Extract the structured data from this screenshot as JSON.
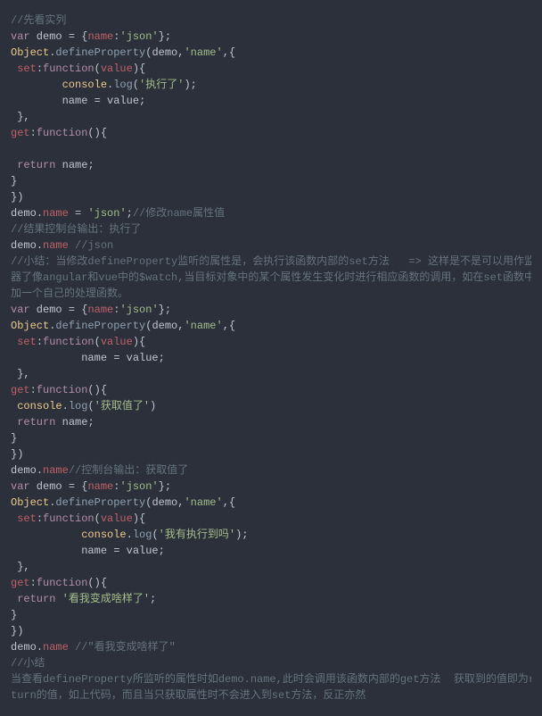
{
  "code": {
    "lines": [
      {
        "segments": [
          {
            "cls": "comment",
            "text": "//先看实列"
          }
        ]
      },
      {
        "segments": [
          {
            "cls": "keyword",
            "text": "var"
          },
          {
            "cls": "plain",
            "text": " demo "
          },
          {
            "cls": "punctuation",
            "text": "= {"
          },
          {
            "cls": "property",
            "text": "name"
          },
          {
            "cls": "punctuation",
            "text": ":"
          },
          {
            "cls": "string",
            "text": "'json'"
          },
          {
            "cls": "punctuation",
            "text": "};"
          }
        ]
      },
      {
        "segments": [
          {
            "cls": "object",
            "text": "Object"
          },
          {
            "cls": "punctuation",
            "text": "."
          },
          {
            "cls": "function-name",
            "text": "defineProperty"
          },
          {
            "cls": "punctuation",
            "text": "("
          },
          {
            "cls": "plain",
            "text": "demo"
          },
          {
            "cls": "punctuation",
            "text": ","
          },
          {
            "cls": "string",
            "text": "'name'"
          },
          {
            "cls": "punctuation",
            "text": ",{"
          }
        ]
      },
      {
        "segments": [
          {
            "cls": "plain",
            "text": " "
          },
          {
            "cls": "property",
            "text": "set"
          },
          {
            "cls": "punctuation",
            "text": ":"
          },
          {
            "cls": "keyword",
            "text": "function"
          },
          {
            "cls": "punctuation",
            "text": "("
          },
          {
            "cls": "variable",
            "text": "value"
          },
          {
            "cls": "punctuation",
            "text": "){"
          }
        ]
      },
      {
        "segments": [
          {
            "cls": "plain",
            "text": "        "
          },
          {
            "cls": "object",
            "text": "console"
          },
          {
            "cls": "punctuation",
            "text": "."
          },
          {
            "cls": "function-name",
            "text": "log"
          },
          {
            "cls": "punctuation",
            "text": "("
          },
          {
            "cls": "string",
            "text": "'执行了'"
          },
          {
            "cls": "punctuation",
            "text": ");"
          }
        ]
      },
      {
        "segments": [
          {
            "cls": "plain",
            "text": "        name "
          },
          {
            "cls": "punctuation",
            "text": "="
          },
          {
            "cls": "plain",
            "text": " value"
          },
          {
            "cls": "punctuation",
            "text": ";"
          }
        ]
      },
      {
        "segments": [
          {
            "cls": "plain",
            "text": " "
          },
          {
            "cls": "punctuation",
            "text": "},"
          }
        ]
      },
      {
        "segments": [
          {
            "cls": "property",
            "text": "get"
          },
          {
            "cls": "punctuation",
            "text": ":"
          },
          {
            "cls": "keyword",
            "text": "function"
          },
          {
            "cls": "punctuation",
            "text": "(){"
          }
        ]
      },
      {
        "segments": [
          {
            "cls": "plain",
            "text": " "
          }
        ]
      },
      {
        "segments": [
          {
            "cls": "plain",
            "text": " "
          },
          {
            "cls": "keyword",
            "text": "return"
          },
          {
            "cls": "plain",
            "text": " name"
          },
          {
            "cls": "punctuation",
            "text": ";"
          }
        ]
      },
      {
        "segments": [
          {
            "cls": "punctuation",
            "text": "}"
          }
        ]
      },
      {
        "segments": [
          {
            "cls": "punctuation",
            "text": "})"
          }
        ]
      },
      {
        "segments": [
          {
            "cls": "plain",
            "text": "demo"
          },
          {
            "cls": "punctuation",
            "text": "."
          },
          {
            "cls": "property",
            "text": "name"
          },
          {
            "cls": "plain",
            "text": " "
          },
          {
            "cls": "punctuation",
            "text": "="
          },
          {
            "cls": "plain",
            "text": " "
          },
          {
            "cls": "string",
            "text": "'json'"
          },
          {
            "cls": "punctuation",
            "text": ";"
          },
          {
            "cls": "comment",
            "text": "//修改name属性值"
          }
        ]
      },
      {
        "segments": [
          {
            "cls": "comment",
            "text": "//结果控制台输出：执行了"
          }
        ]
      },
      {
        "segments": [
          {
            "cls": "plain",
            "text": "demo"
          },
          {
            "cls": "punctuation",
            "text": "."
          },
          {
            "cls": "property",
            "text": "name"
          },
          {
            "cls": "plain",
            "text": " "
          },
          {
            "cls": "comment",
            "text": "//json"
          }
        ]
      },
      {
        "segments": [
          {
            "cls": "comment",
            "text": "//小结：当修改defineProperty监听的属性是，会执行该函数内部的set方法   => 这样是不是可以用作监听"
          }
        ]
      },
      {
        "segments": [
          {
            "cls": "comment",
            "text": "器了像angular和vue中的$watch,当目标对象中的某个属性发生变化时进行相应函数的调用，如在set函数中"
          }
        ]
      },
      {
        "segments": [
          {
            "cls": "comment",
            "text": "加一个自己的处理函数。"
          }
        ]
      },
      {
        "segments": [
          {
            "cls": "keyword",
            "text": "var"
          },
          {
            "cls": "plain",
            "text": " demo "
          },
          {
            "cls": "punctuation",
            "text": "= {"
          },
          {
            "cls": "property",
            "text": "name"
          },
          {
            "cls": "punctuation",
            "text": ":"
          },
          {
            "cls": "string",
            "text": "'json'"
          },
          {
            "cls": "punctuation",
            "text": "};"
          }
        ]
      },
      {
        "segments": [
          {
            "cls": "object",
            "text": "Object"
          },
          {
            "cls": "punctuation",
            "text": "."
          },
          {
            "cls": "function-name",
            "text": "defineProperty"
          },
          {
            "cls": "punctuation",
            "text": "("
          },
          {
            "cls": "plain",
            "text": "demo"
          },
          {
            "cls": "punctuation",
            "text": ","
          },
          {
            "cls": "string",
            "text": "'name'"
          },
          {
            "cls": "punctuation",
            "text": ",{"
          }
        ]
      },
      {
        "segments": [
          {
            "cls": "plain",
            "text": " "
          },
          {
            "cls": "property",
            "text": "set"
          },
          {
            "cls": "punctuation",
            "text": ":"
          },
          {
            "cls": "keyword",
            "text": "function"
          },
          {
            "cls": "punctuation",
            "text": "("
          },
          {
            "cls": "variable",
            "text": "value"
          },
          {
            "cls": "punctuation",
            "text": "){"
          }
        ]
      },
      {
        "segments": [
          {
            "cls": "plain",
            "text": "           name "
          },
          {
            "cls": "punctuation",
            "text": "="
          },
          {
            "cls": "plain",
            "text": " value"
          },
          {
            "cls": "punctuation",
            "text": ";"
          }
        ]
      },
      {
        "segments": [
          {
            "cls": "plain",
            "text": " "
          },
          {
            "cls": "punctuation",
            "text": "},"
          }
        ]
      },
      {
        "segments": [
          {
            "cls": "property",
            "text": "get"
          },
          {
            "cls": "punctuation",
            "text": ":"
          },
          {
            "cls": "keyword",
            "text": "function"
          },
          {
            "cls": "punctuation",
            "text": "(){"
          }
        ]
      },
      {
        "segments": [
          {
            "cls": "plain",
            "text": " "
          },
          {
            "cls": "object",
            "text": "console"
          },
          {
            "cls": "punctuation",
            "text": "."
          },
          {
            "cls": "function-name",
            "text": "log"
          },
          {
            "cls": "punctuation",
            "text": "("
          },
          {
            "cls": "string",
            "text": "'获取值了'"
          },
          {
            "cls": "punctuation",
            "text": ")"
          }
        ]
      },
      {
        "segments": [
          {
            "cls": "plain",
            "text": " "
          },
          {
            "cls": "keyword",
            "text": "return"
          },
          {
            "cls": "plain",
            "text": " name"
          },
          {
            "cls": "punctuation",
            "text": ";"
          }
        ]
      },
      {
        "segments": [
          {
            "cls": "punctuation",
            "text": "}"
          }
        ]
      },
      {
        "segments": [
          {
            "cls": "punctuation",
            "text": "})"
          }
        ]
      },
      {
        "segments": [
          {
            "cls": "plain",
            "text": "demo"
          },
          {
            "cls": "punctuation",
            "text": "."
          },
          {
            "cls": "property",
            "text": "name"
          },
          {
            "cls": "comment",
            "text": "//控制台输出：获取值了"
          }
        ]
      },
      {
        "segments": [
          {
            "cls": "keyword",
            "text": "var"
          },
          {
            "cls": "plain",
            "text": " demo "
          },
          {
            "cls": "punctuation",
            "text": "= {"
          },
          {
            "cls": "property",
            "text": "name"
          },
          {
            "cls": "punctuation",
            "text": ":"
          },
          {
            "cls": "string",
            "text": "'json'"
          },
          {
            "cls": "punctuation",
            "text": "};"
          }
        ]
      },
      {
        "segments": [
          {
            "cls": "object",
            "text": "Object"
          },
          {
            "cls": "punctuation",
            "text": "."
          },
          {
            "cls": "function-name",
            "text": "defineProperty"
          },
          {
            "cls": "punctuation",
            "text": "("
          },
          {
            "cls": "plain",
            "text": "demo"
          },
          {
            "cls": "punctuation",
            "text": ","
          },
          {
            "cls": "string",
            "text": "'name'"
          },
          {
            "cls": "punctuation",
            "text": ",{"
          }
        ]
      },
      {
        "segments": [
          {
            "cls": "plain",
            "text": " "
          },
          {
            "cls": "property",
            "text": "set"
          },
          {
            "cls": "punctuation",
            "text": ":"
          },
          {
            "cls": "keyword",
            "text": "function"
          },
          {
            "cls": "punctuation",
            "text": "("
          },
          {
            "cls": "variable",
            "text": "value"
          },
          {
            "cls": "punctuation",
            "text": "){"
          }
        ]
      },
      {
        "segments": [
          {
            "cls": "plain",
            "text": "           "
          },
          {
            "cls": "object",
            "text": "console"
          },
          {
            "cls": "punctuation",
            "text": "."
          },
          {
            "cls": "function-name",
            "text": "log"
          },
          {
            "cls": "punctuation",
            "text": "("
          },
          {
            "cls": "string",
            "text": "'我有执行到吗'"
          },
          {
            "cls": "punctuation",
            "text": ");"
          }
        ]
      },
      {
        "segments": [
          {
            "cls": "plain",
            "text": "           name "
          },
          {
            "cls": "punctuation",
            "text": "="
          },
          {
            "cls": "plain",
            "text": " value"
          },
          {
            "cls": "punctuation",
            "text": ";"
          }
        ]
      },
      {
        "segments": [
          {
            "cls": "plain",
            "text": " "
          },
          {
            "cls": "punctuation",
            "text": "},"
          }
        ]
      },
      {
        "segments": [
          {
            "cls": "property",
            "text": "get"
          },
          {
            "cls": "punctuation",
            "text": ":"
          },
          {
            "cls": "keyword",
            "text": "function"
          },
          {
            "cls": "punctuation",
            "text": "(){"
          }
        ]
      },
      {
        "segments": [
          {
            "cls": "plain",
            "text": " "
          },
          {
            "cls": "keyword",
            "text": "return"
          },
          {
            "cls": "plain",
            "text": " "
          },
          {
            "cls": "string",
            "text": "'看我变成啥样了'"
          },
          {
            "cls": "punctuation",
            "text": ";"
          }
        ]
      },
      {
        "segments": [
          {
            "cls": "punctuation",
            "text": "}"
          }
        ]
      },
      {
        "segments": [
          {
            "cls": "punctuation",
            "text": "})"
          }
        ]
      },
      {
        "segments": [
          {
            "cls": "plain",
            "text": "demo"
          },
          {
            "cls": "punctuation",
            "text": "."
          },
          {
            "cls": "property",
            "text": "name"
          },
          {
            "cls": "plain",
            "text": " "
          },
          {
            "cls": "comment",
            "text": "//\"看我变成啥样了\""
          }
        ]
      },
      {
        "segments": [
          {
            "cls": "comment",
            "text": "//小结"
          }
        ]
      },
      {
        "segments": [
          {
            "cls": "comment",
            "text": "当查看defineProperty所监听的属性时如demo.name,此时会调用该函数内部的get方法  获取到的值即为re"
          }
        ]
      },
      {
        "segments": [
          {
            "cls": "comment",
            "text": "turn的值，如上代码，而且当只获取属性时不会进入到set方法，反正亦然"
          }
        ]
      }
    ]
  }
}
